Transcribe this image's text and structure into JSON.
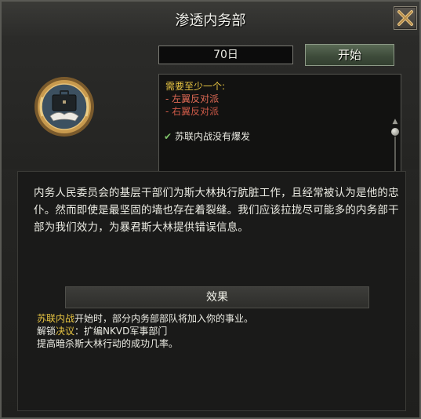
{
  "window": {
    "title": "渗透内务部"
  },
  "controls": {
    "days": "70日",
    "start_label": "开始"
  },
  "requirements": {
    "header": "需要至少一个:",
    "options": [
      "- 左翼反对派",
      "- 右翼反对派"
    ],
    "condition": "苏联内战没有爆发",
    "header_color": "#e8c542",
    "option_color": "#e06a55"
  },
  "description": "内务人民委员会的基层干部们为斯大林执行肮脏工作，且经常被认为是他的忠仆。然而即使是最坚固的墙也存在着裂缝。我们应该拉拢尽可能多的内务部干部为我们效力，为暴君斯大林提供错误信息。",
  "effects": {
    "header": "效果",
    "line1_highlight": "苏联内战",
    "line1_rest": "开始时，部分内务部部队将加入你的事业。",
    "line2_prefix": "解锁",
    "line2_highlight": "决议",
    "line2_rest": "：扩编NKVD军事部门",
    "line3": "提高暗杀斯大林行动的成功几率。",
    "highlight_color": "#e8c542"
  },
  "icons": {
    "close": "close-icon",
    "medal": "briefcase-handshake-medal-icon",
    "check": "checkmark-icon"
  }
}
